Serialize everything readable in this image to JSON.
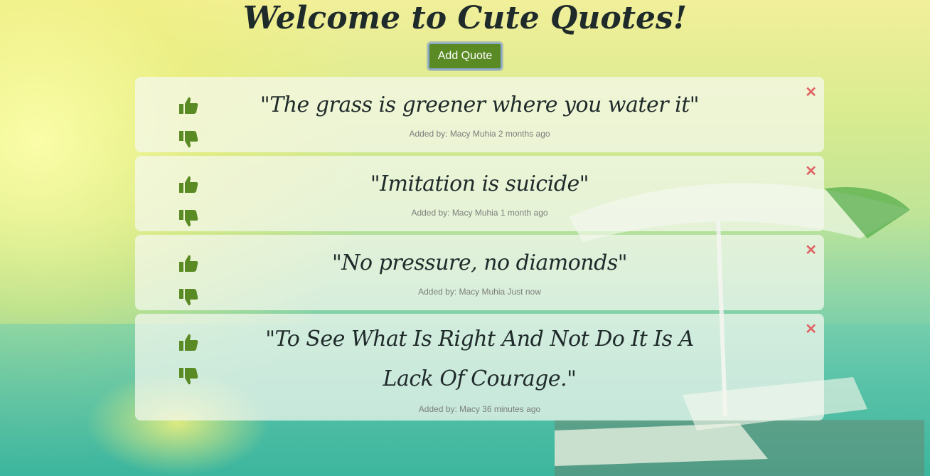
{
  "header": {
    "title": "Welcome to Cute Quotes!"
  },
  "toolbar": {
    "add_label": "Add Quote"
  },
  "icons": {
    "upvote": "thumbs-up-icon",
    "downvote": "thumbs-down-icon",
    "delete": "close-icon"
  },
  "colors": {
    "accent": "#5a8a24",
    "delete": "#e06565",
    "text": "#1f2a2a"
  },
  "quotes": [
    {
      "text": "\"The grass is greener where you water it\"",
      "meta": "Added by: Macy Muhia 2 months ago"
    },
    {
      "text": "\"Imitation is suicide\"",
      "meta": "Added by: Macy Muhia 1 month ago"
    },
    {
      "text": "\"No pressure, no diamonds\"",
      "meta": "Added by: Macy Muhia Just now"
    },
    {
      "text": "\"To See What Is Right And Not Do It Is A Lack Of Courage.\"",
      "meta": "Added by: Macy 36 minutes ago"
    }
  ]
}
